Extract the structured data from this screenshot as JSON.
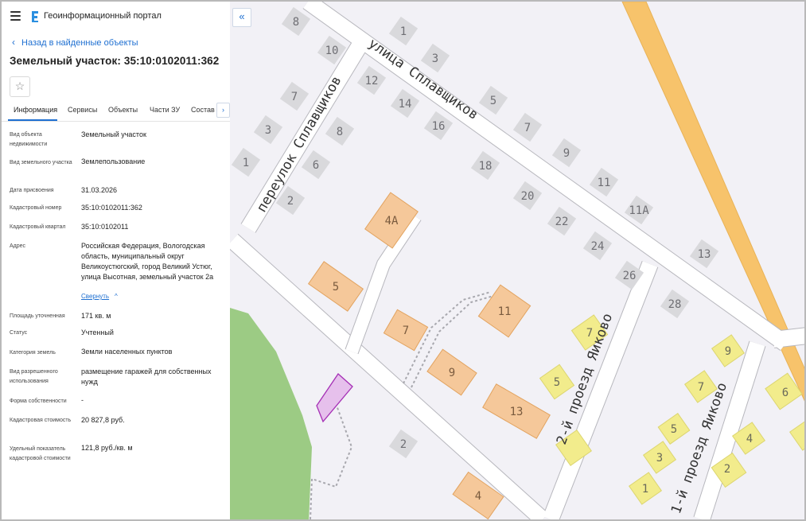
{
  "header": {
    "app_title": "Геоинформационный портал"
  },
  "nav": {
    "back_label": "Назад в найденные объекты"
  },
  "object": {
    "title": "Земельный участок: 35:10:0102011:362"
  },
  "tabs": [
    {
      "label": "Информация",
      "active": true
    },
    {
      "label": "Сервисы"
    },
    {
      "label": "Объекты"
    },
    {
      "label": "Части ЗУ"
    },
    {
      "label": "Состав"
    }
  ],
  "properties": [
    {
      "label": "Вид объекта недвижимости",
      "value": "Земельный участок"
    },
    {
      "label": "Вид земельного участка",
      "value": "Землепользование"
    },
    {
      "label": "Дата присвоения",
      "value": "31.03.2026"
    },
    {
      "label": "Кадастровый номер",
      "value": "35:10:0102011:362"
    },
    {
      "label": "Кадастровый квартал",
      "value": "35:10:0102011"
    },
    {
      "label": "Адрес",
      "value": "Российская Федерация, Вологодская область, муниципальный округ Великоустюгский, город Великий Устюг, улица Высотная, земельный участок 2а"
    },
    {
      "label": "Площадь уточненная",
      "value": "171 кв. м"
    },
    {
      "label": "Статус",
      "value": "Учтенный"
    },
    {
      "label": "Категория земель",
      "value": "Земли населенных пунктов"
    },
    {
      "label": "Вид разрешенного использования",
      "value": "размещение гаражей для собственных нужд"
    },
    {
      "label": "Форма собственности",
      "value": "-"
    },
    {
      "label": "Кадастровая стоимость",
      "value": "20 827,8 руб."
    },
    {
      "label": "Удельный показатель кадастровой стоимости",
      "value": "121,8 руб./кв. м"
    }
  ],
  "collapse_label": "Свернуть",
  "map": {
    "streets": [
      "улица Сплавщиков",
      "переулок Сплавщиков",
      "2-й проезд Яиково",
      "1-й проезд Яиково"
    ],
    "gray_labels": [
      "8",
      "10",
      "12",
      "7",
      "3",
      "1",
      "6",
      "8",
      "2",
      "1",
      "3",
      "14",
      "16",
      "5",
      "7",
      "9",
      "18",
      "20",
      "22",
      "11",
      "11А",
      "24",
      "26",
      "28",
      "13",
      "2"
    ],
    "orange_labels": [
      "4А",
      "5",
      "7",
      "11",
      "9",
      "13",
      "4"
    ],
    "yellow_labels": [
      "7",
      "5",
      "9",
      "7",
      "6",
      "5",
      "3",
      "4",
      "2",
      "1"
    ],
    "colors": {
      "background": "#f2f1f6",
      "road": "#ffffff",
      "road_edge": "#b7b7bd",
      "highway": "#f7c36b",
      "building_gray": "#d9d9dc",
      "building_orange": "#f5c89a",
      "building_yellow": "#f2ec8c",
      "selected_parcel": "#e6c0ec",
      "green": "#9ccb84"
    }
  }
}
